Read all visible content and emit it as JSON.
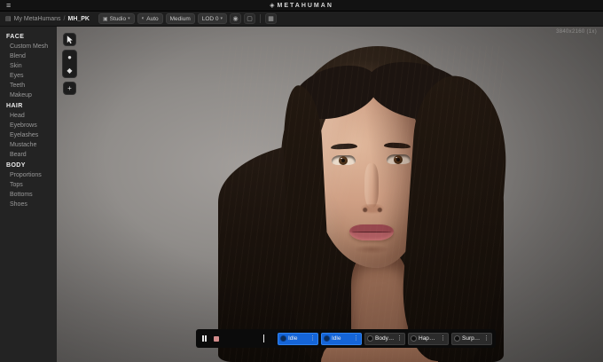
{
  "topbar": {
    "logo": "METAHUMAN"
  },
  "header": {
    "breadcrumb": {
      "root": "My MetaHumans",
      "separator": "/",
      "current": "MH_PK"
    },
    "toolbar": {
      "studio": "Studio",
      "auto": "Auto",
      "quality": "Medium",
      "lod": "LOD 0"
    }
  },
  "sidebar": {
    "sections": [
      {
        "title": "FACE",
        "items": [
          "Custom Mesh",
          "Blend",
          "Skin",
          "Eyes",
          "Teeth",
          "Makeup"
        ]
      },
      {
        "title": "HAIR",
        "items": [
          "Head",
          "Eyebrows",
          "Eyelashes",
          "Mustache",
          "Beard"
        ]
      },
      {
        "title": "BODY",
        "items": [
          "Proportions",
          "Tops",
          "Bottoms",
          "Shoes"
        ]
      }
    ]
  },
  "viewport": {
    "stats": "3840x2160 (1x)"
  },
  "timeline": {
    "slots": [
      {
        "label": "Idle",
        "active": true
      },
      {
        "label": "Idle",
        "active": true
      },
      {
        "label": "Body ROM",
        "active": false
      },
      {
        "label": "Happy A",
        "active": false
      },
      {
        "label": "Surprise",
        "active": false
      }
    ]
  },
  "colors": {
    "accent_blue": "#1565d8",
    "topbar_bg": "#121212",
    "sidebar_bg": "#232323",
    "timeline_bg": "#0b0b0b"
  }
}
